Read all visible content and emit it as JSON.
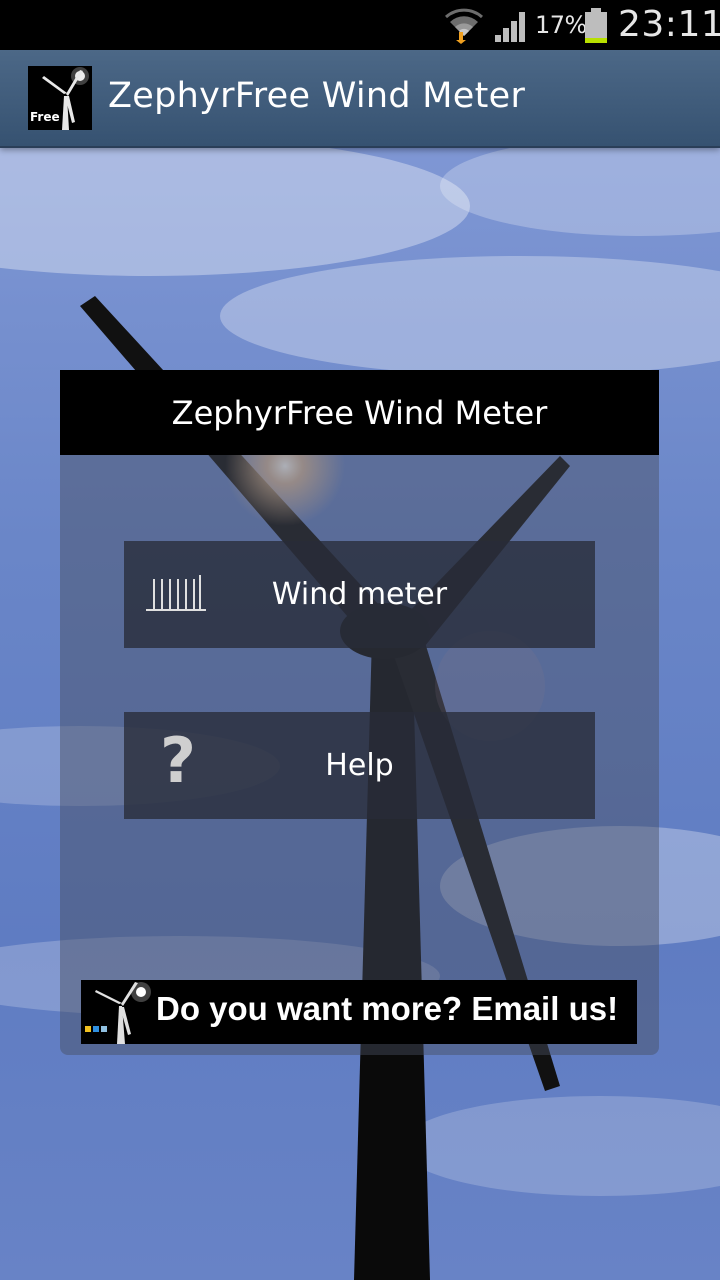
{
  "status_bar": {
    "battery_percent": "17%",
    "battery_level": 0.17,
    "time": "23:11",
    "icons": [
      "wifi-icon",
      "signal-icon",
      "battery-icon"
    ]
  },
  "action_bar": {
    "title": "ZephyrFree Wind Meter",
    "icon_label": "Free"
  },
  "dialog": {
    "title": "ZephyrFree Wind Meter",
    "buttons": [
      {
        "label": "Wind meter",
        "icon": "wind-meter-icon"
      },
      {
        "label": "Help",
        "icon": "help-icon",
        "glyph": "?"
      }
    ],
    "banner": {
      "text": "Do you want more? Email us!"
    }
  },
  "colors": {
    "sky": "#6b86c9",
    "action_bar": "#42607f",
    "battery_fill": "#b8e000"
  }
}
